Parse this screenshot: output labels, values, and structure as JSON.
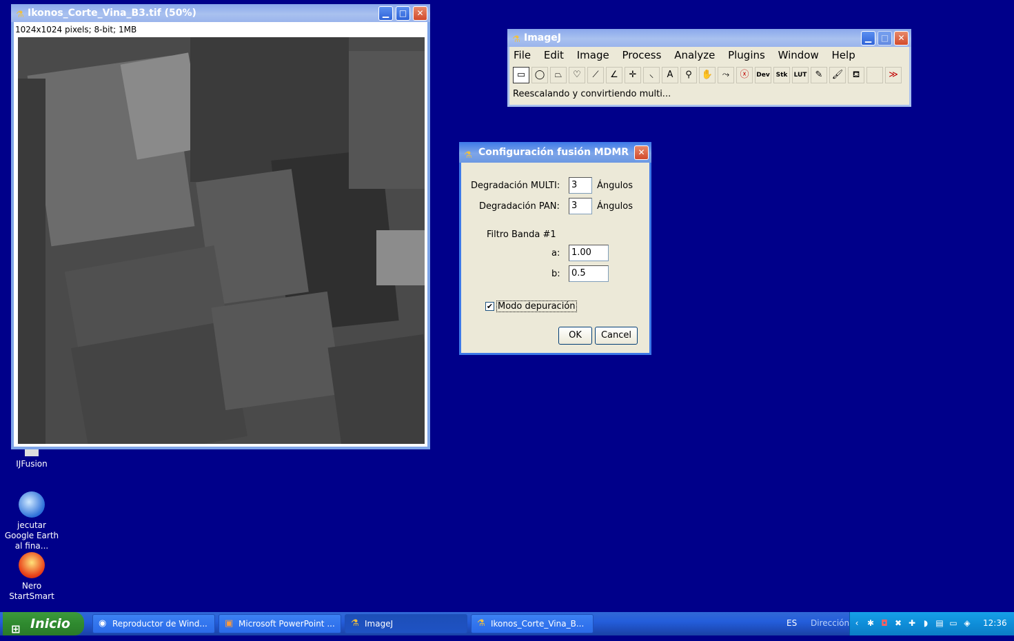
{
  "image_window": {
    "title": "Ikonos_Corte_Vina_B3.tif (50%)",
    "info": "1024x1024 pixels; 8-bit; 1MB"
  },
  "imagej_window": {
    "title": "ImageJ",
    "menu": [
      "File",
      "Edit",
      "Image",
      "Process",
      "Analyze",
      "Plugins",
      "Window",
      "Help"
    ],
    "tools": [
      {
        "name": "rectangle-tool-icon",
        "glyph": "▭"
      },
      {
        "name": "oval-tool-icon",
        "glyph": "◯"
      },
      {
        "name": "polygon-tool-icon",
        "glyph": "⏢"
      },
      {
        "name": "freehand-tool-icon",
        "glyph": "♡"
      },
      {
        "name": "line-tool-icon",
        "glyph": "⟋"
      },
      {
        "name": "angle-tool-icon",
        "glyph": "∠"
      },
      {
        "name": "point-tool-icon",
        "glyph": "✛"
      },
      {
        "name": "wand-tool-icon",
        "glyph": "⸜"
      },
      {
        "name": "text-tool-icon",
        "glyph": "A"
      },
      {
        "name": "magnifier-tool-icon",
        "glyph": "⚲"
      },
      {
        "name": "hand-tool-icon",
        "glyph": "✋"
      },
      {
        "name": "dropper-tool-icon",
        "glyph": "⤳"
      },
      {
        "name": "stop-tool-icon",
        "glyph": "ⓧ"
      },
      {
        "name": "dev-tool-icon",
        "glyph": "Dev"
      },
      {
        "name": "stk-tool-icon",
        "glyph": "Stk"
      },
      {
        "name": "lut-tool-icon",
        "glyph": "LUT"
      },
      {
        "name": "pencil-tool-icon",
        "glyph": "✎"
      },
      {
        "name": "brush-tool-icon",
        "glyph": "🖌"
      },
      {
        "name": "flood-fill-tool-icon",
        "glyph": "⛾"
      },
      {
        "name": "empty-tool-slot",
        "glyph": ""
      },
      {
        "name": "more-tools-icon",
        "glyph": "≫"
      }
    ],
    "status": "Reescalando y convirtiendo multi..."
  },
  "dialog": {
    "title": "Configuración fusión MDMR",
    "multi_label": "Degradación MULTI:",
    "multi_value": "3",
    "multi_unit": "Ángulos",
    "pan_label": "Degradación PAN:",
    "pan_value": "3",
    "pan_unit": "Ángulos",
    "filter_label": "Filtro Banda #1",
    "a_label": "a:",
    "a_value": "1.00",
    "b_label": "b:",
    "b_value": "0.5",
    "debug_label": "Modo depuración",
    "debug_checked": "✔",
    "ok": "OK",
    "cancel": "Cancel"
  },
  "desktop_icons": [
    {
      "label": "IJFusion"
    },
    {
      "label": "jecutar Google Earth al fina..."
    },
    {
      "label": "Nero StartSmart"
    }
  ],
  "taskbar": {
    "start": "Inicio",
    "tasks": [
      {
        "label": "Reproductor de Wind..."
      },
      {
        "label": "Microsoft PowerPoint ..."
      },
      {
        "label": "ImageJ"
      },
      {
        "label": "Ikonos_Corte_Vina_B..."
      }
    ],
    "lang": "ES",
    "address": "Dirección",
    "clock": "12:36"
  },
  "colors": {
    "desktop": "#00008a",
    "titlebar_active": "#3d79e8",
    "dialog_bg": "#ece9d8",
    "taskbar": "#245edb",
    "start_button": "#2f8a2f"
  }
}
